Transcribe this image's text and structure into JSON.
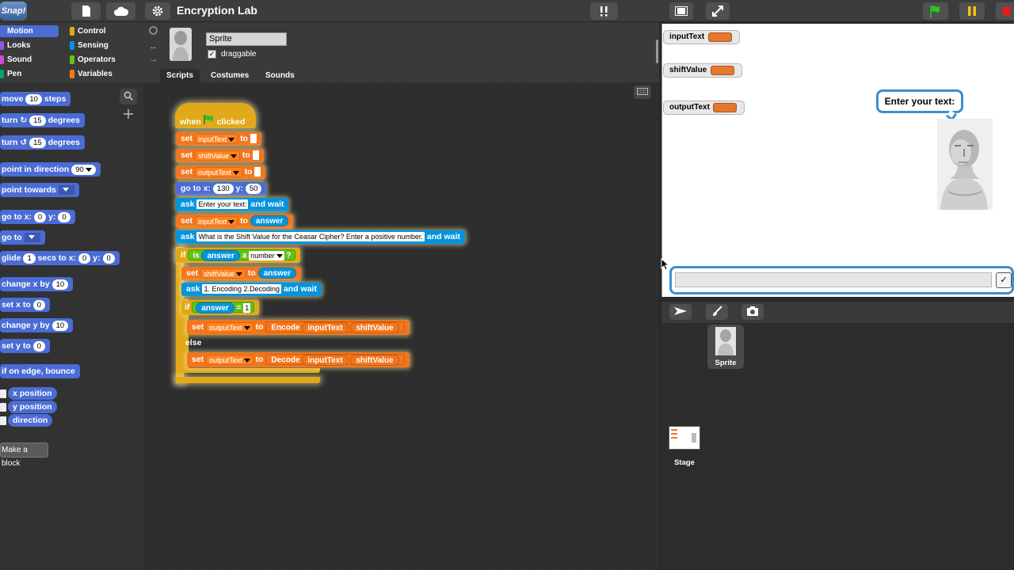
{
  "app": {
    "logo": "Snap!",
    "title": "Encryption Lab"
  },
  "toolbar": {
    "icons": [
      "file-icon",
      "cloud-icon",
      "gear-icon",
      "unsaved-icon",
      "stage-size-icon",
      "fullscreen-icon",
      "green-flag-icon",
      "pause-icon",
      "stop-icon"
    ]
  },
  "categories": [
    {
      "label": "Motion",
      "color": "#4a6cd4"
    },
    {
      "label": "Control",
      "color": "#e1a91a"
    },
    {
      "label": "Looks",
      "color": "#8f56e3"
    },
    {
      "label": "Sensing",
      "color": "#0494dc"
    },
    {
      "label": "Sound",
      "color": "#cf4ad9"
    },
    {
      "label": "Operators",
      "color": "#62c213"
    },
    {
      "label": "Pen",
      "color": "#00a178"
    },
    {
      "label": "Variables",
      "color": "#f3761d"
    }
  ],
  "palette": {
    "move_pre": "move",
    "move_val": "10",
    "move_post": "steps",
    "turn_cw_pre": "turn",
    "turn_cw_val": "15",
    "turn_cw_post": "degrees",
    "turn_ccw_pre": "turn",
    "turn_ccw_val": "15",
    "turn_ccw_post": "degrees",
    "point_dir": "point in direction",
    "point_dir_val": "90",
    "point_towards": "point towards",
    "goto_xy_pre": "go to x:",
    "goto_xy_x": "0",
    "goto_xy_mid": "y:",
    "goto_xy_y": "0",
    "goto": "go to",
    "glide_pre": "glide",
    "glide_val": "1",
    "glide_mid": "secs to x:",
    "glide_x": "0",
    "glide_mid2": "y:",
    "glide_y": "0",
    "change_x": "change x by",
    "change_x_val": "10",
    "set_x": "set x to",
    "set_x_val": "0",
    "change_y": "change y by",
    "change_y_val": "10",
    "set_y": "set y to",
    "set_y_val": "0",
    "bounce": "if on edge, bounce",
    "x_position": "x position",
    "y_position": "y position",
    "direction": "direction",
    "make_block": "Make a block"
  },
  "sprite": {
    "name": "Sprite",
    "draggable_label": "draggable",
    "draggable": true
  },
  "tabs": [
    "Scripts",
    "Costumes",
    "Sounds"
  ],
  "script": {
    "hat_when": "when",
    "hat_clicked": "clicked",
    "set": "set",
    "to": "to",
    "var_input": "inputText",
    "var_shift": "shiftValue",
    "var_output": "outputText",
    "goto_pre": "go to x:",
    "goto_x": "130",
    "goto_mid": "y:",
    "goto_y": "50",
    "ask": "ask",
    "and_wait": "and wait",
    "ask1": "Enter your text:",
    "answer": "answer",
    "ask2": "What is the Shift Value for the Ceasar Cipher? Enter a positive number.",
    "if": "if",
    "is": "is",
    "a": "a",
    "number": "number",
    "qmark": "?",
    "ask3": "1. Encoding 2.Decoding",
    "eq": "=",
    "eq_val": "1",
    "encode": "Encode",
    "decode": "Decode",
    "else": "else"
  },
  "stage": {
    "watchers": [
      "inputText",
      "shiftValue",
      "outputText"
    ],
    "bubble": "Enter your text:",
    "ask_input": "",
    "ok": "✓"
  },
  "corral": {
    "sprite_label": "Sprite",
    "stage_label": "Stage"
  }
}
